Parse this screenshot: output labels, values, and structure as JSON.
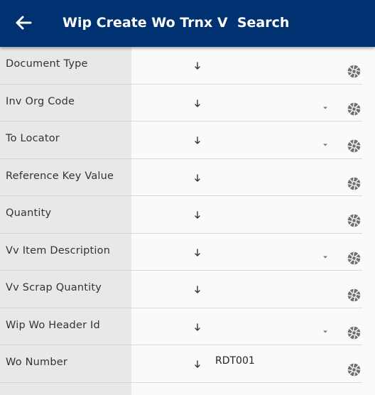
{
  "header": {
    "title": "Wip Create Wo Trnx V  Search",
    "back_icon": "arrow-left-icon",
    "background": "#003271"
  },
  "fields": [
    {
      "label": "Document Type",
      "value": "",
      "dropdown": false
    },
    {
      "label": "Inv Org Code",
      "value": "",
      "dropdown": true
    },
    {
      "label": "To Locator",
      "value": "",
      "dropdown": true
    },
    {
      "label": "Reference Key Value",
      "value": "",
      "dropdown": false
    },
    {
      "label": "Quantity",
      "value": "",
      "dropdown": false
    },
    {
      "label": "Vv Item Description",
      "value": "",
      "dropdown": true
    },
    {
      "label": "Vv Scrap Quantity",
      "value": "",
      "dropdown": false
    },
    {
      "label": "Wip Wo Header Id",
      "value": "",
      "dropdown": true
    },
    {
      "label": "Wo Number",
      "value": "RDT001",
      "dropdown": false
    }
  ],
  "icons": {
    "sort": "sort-arrow-icon",
    "dropdown": "chevron-down-icon",
    "lens": "camera-lens-icon"
  }
}
